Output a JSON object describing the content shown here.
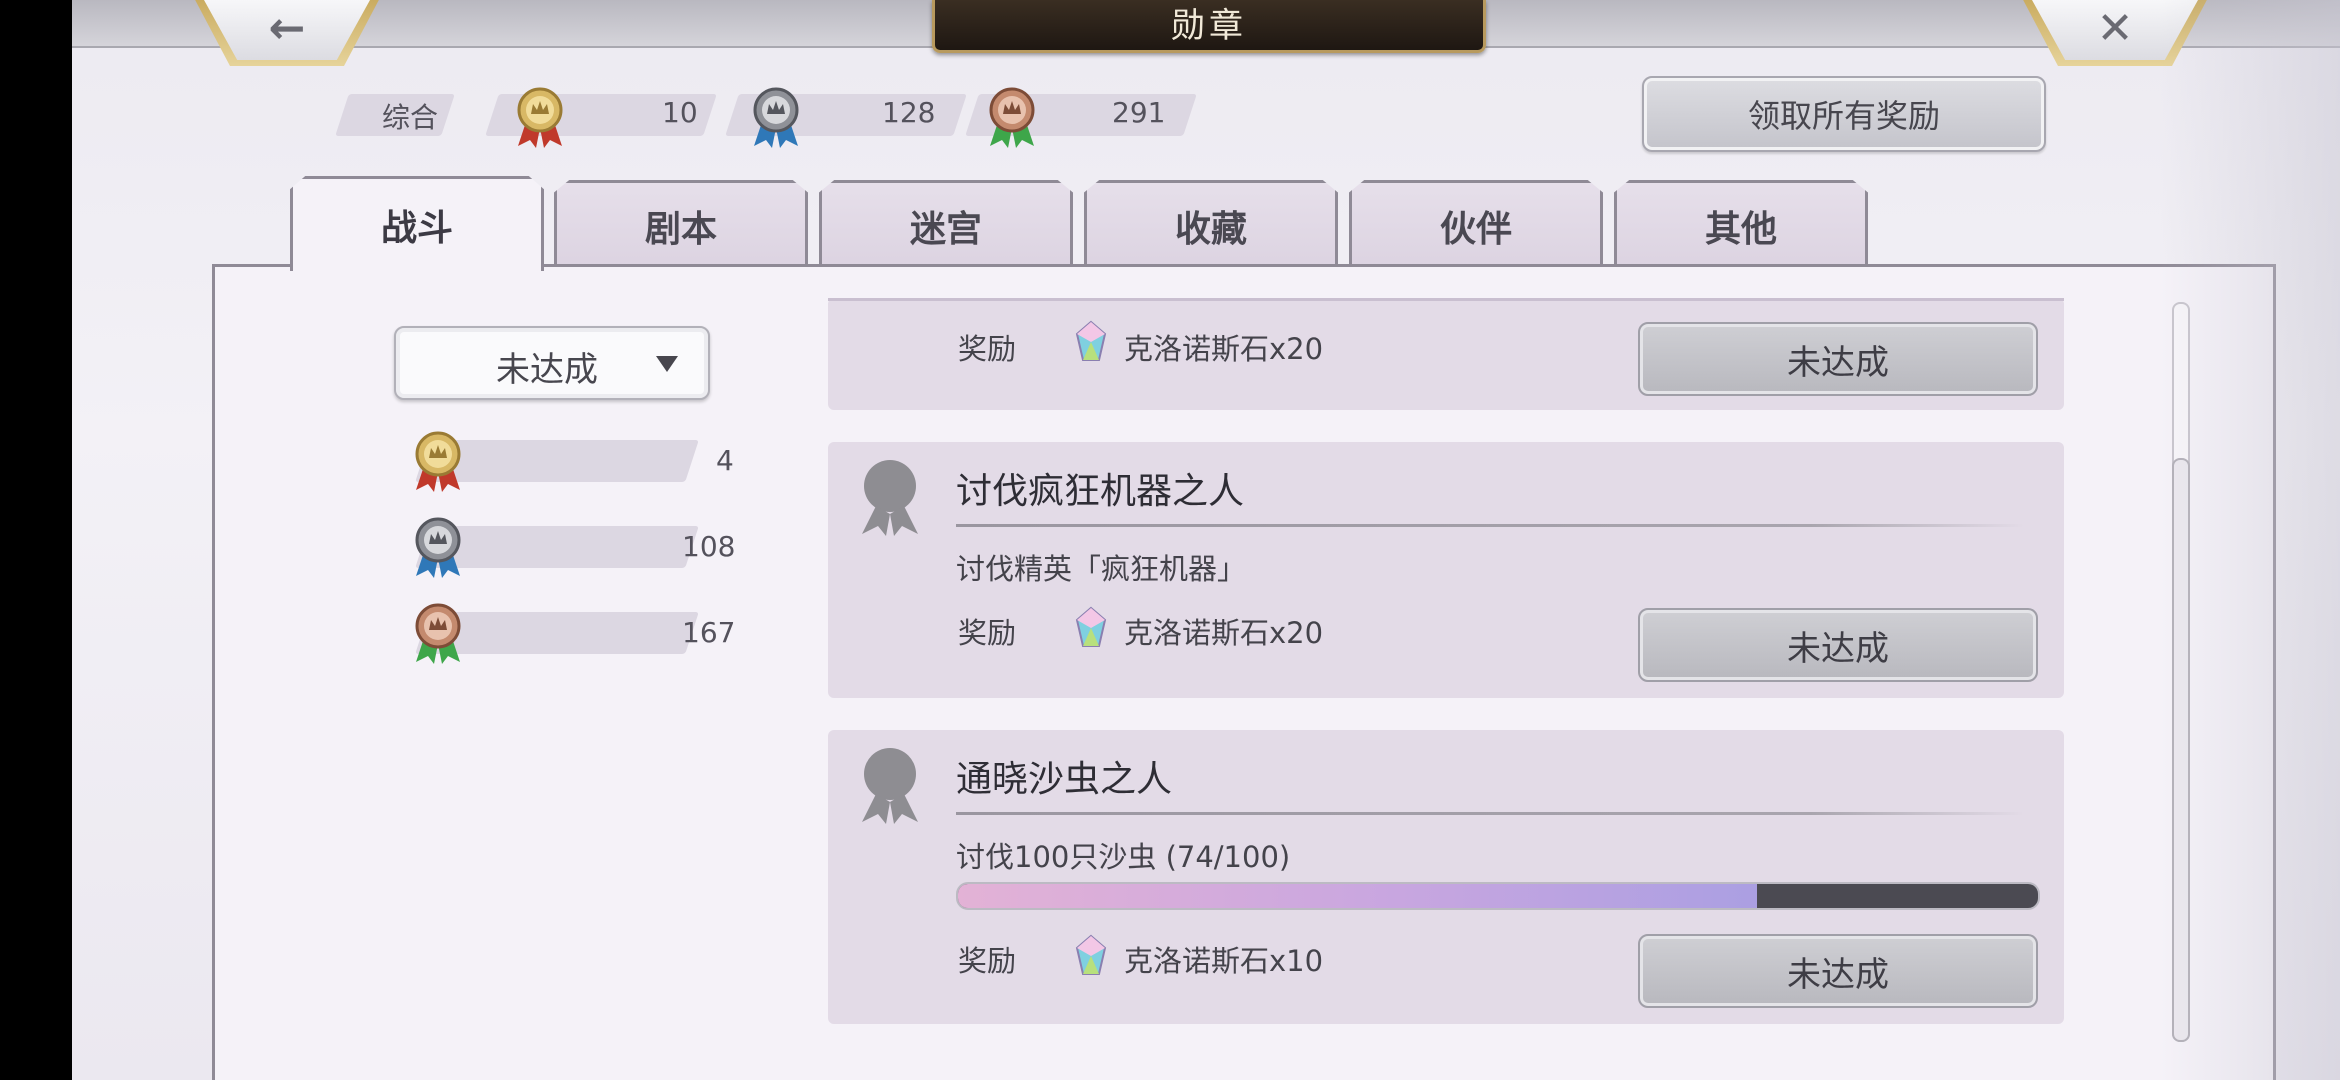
{
  "header": {
    "title": "勋章",
    "back_icon": "←",
    "close_icon": "✕"
  },
  "summary": {
    "label": "综合",
    "gold_count": "10",
    "silver_count": "128",
    "bronze_count": "291"
  },
  "claim_all_label": "领取所有奖励",
  "tabs": [
    {
      "label": "战斗",
      "active": true
    },
    {
      "label": "剧本",
      "active": false
    },
    {
      "label": "迷宫",
      "active": false
    },
    {
      "label": "收藏",
      "active": false
    },
    {
      "label": "伙伴",
      "active": false
    },
    {
      "label": "其他",
      "active": false
    }
  ],
  "filter": {
    "selected": "未达成"
  },
  "side_counts": {
    "gold": "4",
    "silver": "108",
    "bronze": "167"
  },
  "cards": [
    {
      "reward_label": "奖励",
      "reward_value": "克洛诺斯石x20",
      "state": "未达成"
    },
    {
      "title": "讨伐疯狂机器之人",
      "desc": "讨伐精英「疯狂机器」",
      "reward_label": "奖励",
      "reward_value": "克洛诺斯石x20",
      "state": "未达成"
    },
    {
      "title": "通晓沙虫之人",
      "desc": "讨伐100只沙虫 (74/100)",
      "progress": 0.74,
      "reward_label": "奖励",
      "reward_value": "克洛诺斯石x10",
      "state": "未达成"
    }
  ],
  "colors": {
    "gold_ribbon": "#c0392b",
    "silver_ribbon": "#2f78b8",
    "bronze_ribbon": "#3ea64a",
    "gold_medal": "#d8b865",
    "silver_medal": "#8f9198",
    "bronze_medal": "#c48a6e"
  },
  "icons": {
    "medal_icon": "medal",
    "gem_icon": "chronos-stone",
    "locked_badge_icon": "badge-silhouette"
  }
}
